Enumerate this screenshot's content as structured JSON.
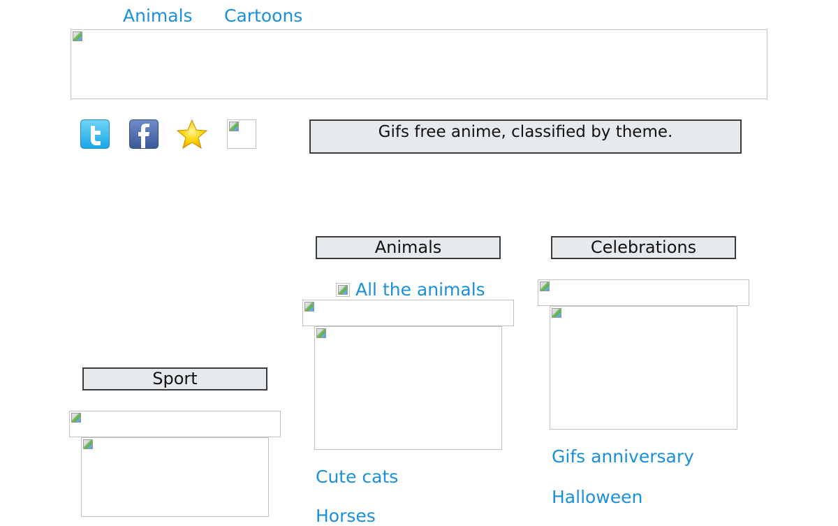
{
  "nav": {
    "animals": "Animals",
    "cartoons": "Cartoons"
  },
  "social": {
    "twitter_icon": "twitter-icon",
    "facebook_icon": "facebook-icon",
    "favorite_icon": "star-icon"
  },
  "tagline": "Gifs free anime, classified by theme.",
  "sections": {
    "animals": {
      "title": "Animals",
      "all_link": "All the animals",
      "links": [
        "Cute cats",
        "Horses"
      ]
    },
    "celebrations": {
      "title": "Celebrations",
      "links": [
        "Gifs anniversary",
        "Halloween"
      ]
    },
    "sport": {
      "title": "Sport"
    }
  },
  "colors": {
    "link": "#1a8fdc",
    "heading_bg": "#e7eaec",
    "heading_border": "#3b3b3b"
  }
}
